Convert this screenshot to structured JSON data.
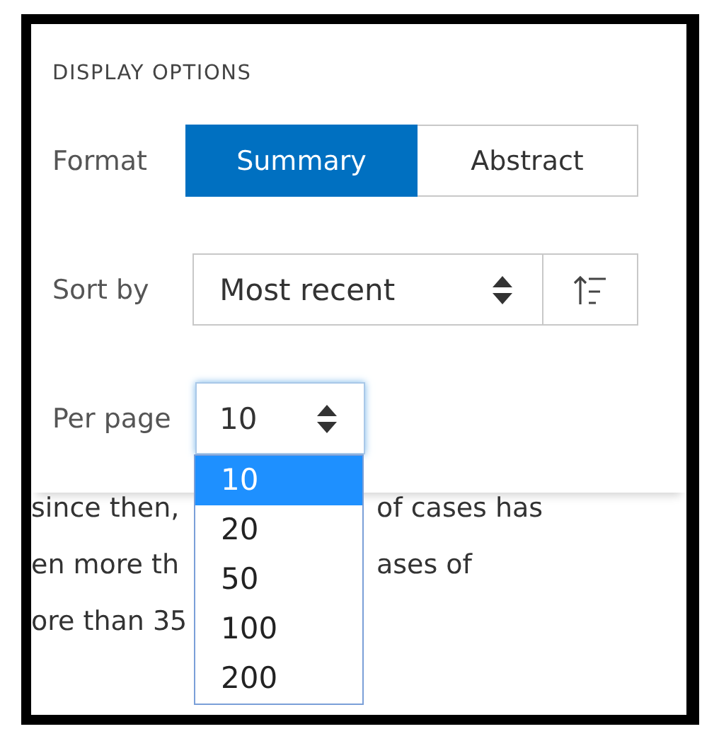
{
  "panel": {
    "title": "DISPLAY OPTIONS",
    "format": {
      "label": "Format",
      "options": [
        {
          "label": "Summary",
          "selected": true
        },
        {
          "label": "Abstract",
          "selected": false
        }
      ]
    },
    "sort": {
      "label": "Sort by",
      "value": "Most recent"
    },
    "per_page": {
      "label": "Per page",
      "value": "10",
      "expanded": true,
      "options": [
        {
          "label": "10",
          "selected": true
        },
        {
          "label": "20",
          "selected": false
        },
        {
          "label": "50",
          "selected": false
        },
        {
          "label": "100",
          "selected": false
        },
        {
          "label": "200",
          "selected": false
        }
      ]
    }
  },
  "background_text": [
    {
      "left": "since then,",
      "right": "of cases has"
    },
    {
      "left": "en more th",
      "right": "ases of"
    },
    {
      "left": "ore than 35"
    }
  ]
}
